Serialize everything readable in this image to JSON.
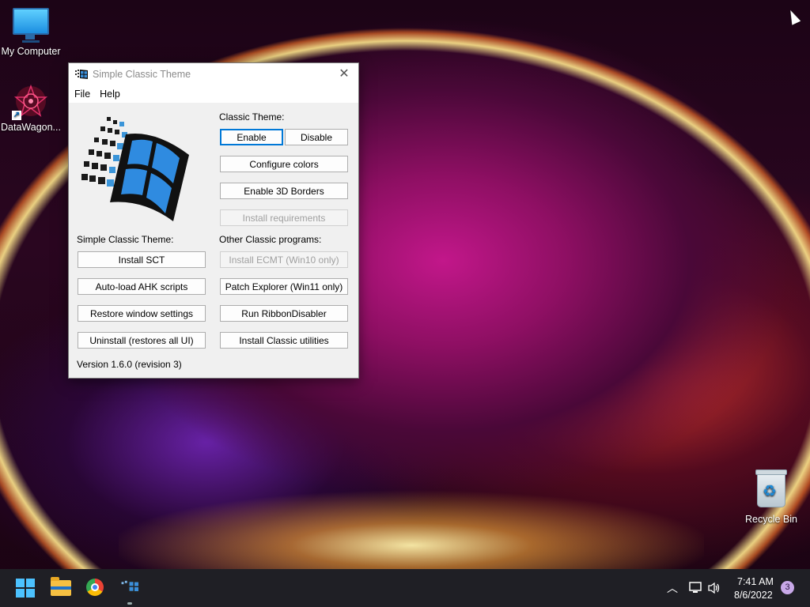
{
  "desktop": {
    "icons": [
      {
        "label": "My Computer",
        "icon": "monitor-icon"
      },
      {
        "label": "DataWagon...",
        "icon": "datawagon-icon"
      },
      {
        "label": "Recycle Bin",
        "icon": "recycle-bin-icon"
      }
    ]
  },
  "window": {
    "title": "Simple Classic Theme",
    "menu": [
      "File",
      "Help"
    ],
    "classic_theme_label": "Classic Theme:",
    "enable_label": "Enable",
    "disable_label": "Disable",
    "configure_colors_label": "Configure colors",
    "enable_3d_borders_label": "Enable 3D Borders",
    "install_requirements_label": "Install requirements",
    "sct_section_label": "Simple Classic Theme:",
    "other_programs_label": "Other Classic programs:",
    "install_sct_label": "Install SCT",
    "autoload_ahk_label": "Auto-load AHK scripts",
    "restore_window_label": "Restore window settings",
    "uninstall_label": "Uninstall (restores all UI)",
    "install_ecmt_label": "Install ECMT (Win10 only)",
    "patch_explorer_label": "Patch Explorer (Win11 only)",
    "run_ribbon_label": "Run RibbonDisabler",
    "install_classic_utils_label": "Install Classic utilities",
    "version_text": "Version 1.6.0 (revision 3)"
  },
  "taskbar": {
    "apps": [
      "start-icon",
      "file-explorer-icon",
      "chrome-icon",
      "simple-classic-theme-icon"
    ],
    "time": "7:41 AM",
    "date": "8/6/2022",
    "notification_count": "3",
    "accent_color": "#4cc2ff"
  }
}
